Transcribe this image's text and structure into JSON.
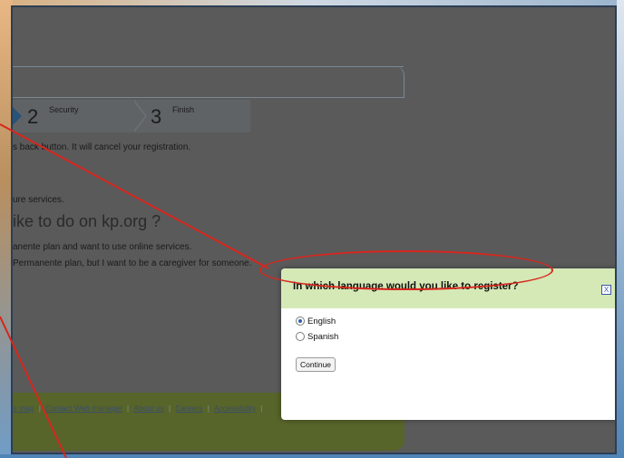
{
  "steps": [
    {
      "number": "2",
      "label": "Security"
    },
    {
      "number": "3",
      "label": "Finish"
    }
  ],
  "notice": "s back button. It will cancel your registration.",
  "services_text": "ure services.",
  "question": "ike to do on kp.org ?",
  "options": [
    "anente plan and want to use online services.",
    "Permanente plan, but I want to be a caregiver for someone."
  ],
  "footer_links": [
    "e map",
    "Contact Web manager",
    "About us",
    "Careers",
    "Accessibility"
  ],
  "dialog": {
    "title": "In which language would you like to register?",
    "close_label": "X",
    "languages": [
      {
        "label": "English",
        "selected": true
      },
      {
        "label": "Spanish",
        "selected": false
      }
    ],
    "continue_label": "Continue"
  },
  "colors": {
    "overlay": "#5a5a5a",
    "dialog_header": "#d5e9b6",
    "annotation": "#d8261d",
    "footer": "#57642a",
    "step_arrow": "#27527a"
  }
}
